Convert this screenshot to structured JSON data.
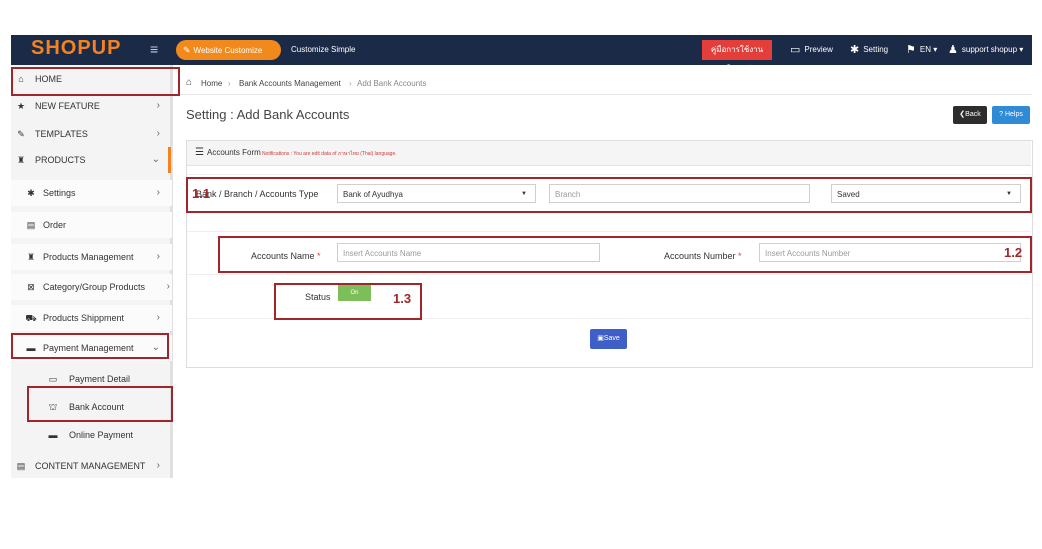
{
  "brand": {
    "logo": "SHOPUP"
  },
  "topbar": {
    "website_customize": "Website Customize",
    "customize_simple": "Customize Simple",
    "manual": "คู่มือการใช้งานเว็บไซต์",
    "preview": "Preview",
    "setting": "Setting",
    "language": "EN",
    "user": "support shopup"
  },
  "sidebar": {
    "home": "HOME",
    "new_feature": "NEW FEATURE",
    "templates": "TEMPLATES",
    "products": "PRODUCTS",
    "settings": "Settings",
    "order": "Order",
    "products_management": "Products Management",
    "category": "Category/Group Products",
    "shippment": "Products Shippment",
    "payment_management": "Payment Management",
    "payment_detail": "Payment Detail",
    "bank_account": "Bank Account",
    "online_payment": "Online Payment",
    "content_management": "CONTENT MANAGEMENT"
  },
  "breadcrumb": {
    "home": "Home",
    "level1": "Bank Accounts Management",
    "level2": "Add Bank Accounts"
  },
  "page": {
    "title": "Setting : Add Bank Accounts",
    "back": "Back",
    "helps": "Helps"
  },
  "form": {
    "header_title": "Accounts Form",
    "header_note": "Notifications : You are edit data of ภาษาไทย (Thai) language.",
    "bank_label": "Bank / Branch / Accounts Type",
    "bank_value": "Bank of Ayudhya",
    "branch_placeholder": "Branch",
    "account_type_value": "Saved",
    "accounts_name_label": "Accounts Name",
    "accounts_name_placeholder": "Insert Accounts Name",
    "accounts_number_label": "Accounts Number",
    "accounts_number_placeholder": "Insert Accounts Number",
    "required_mark": "*",
    "status_label": "Status",
    "status_value": "On",
    "save": "Save"
  },
  "annotations": {
    "a1_1": "1.1",
    "a1_2": "1.2",
    "a1_3": "1.3"
  },
  "colors": {
    "navbar": "#1b2a47",
    "brand_orange": "#f5821f",
    "annotation": "#a0262a",
    "save_button": "#3f5fc8",
    "status_on": "#7cbf5a"
  }
}
